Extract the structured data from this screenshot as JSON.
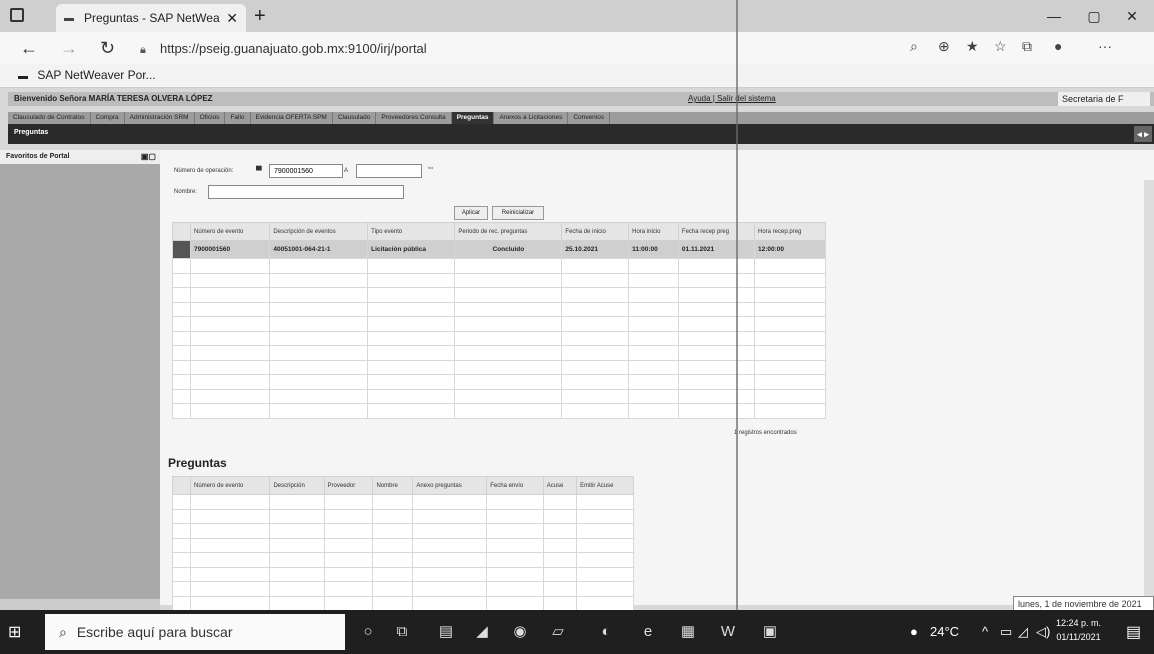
{
  "browser": {
    "tab_title": "Preguntas - SAP NetWeaver Port",
    "tab_close": "✕",
    "new_tab": "+",
    "url": "https://pseig.guanajuato.gob.mx:9100/irj/portal",
    "favorite": "SAP NetWeaver Por...",
    "win_min": "—",
    "win_max": "▢",
    "win_close": "✕"
  },
  "portal": {
    "welcome": "Bienvenido Señora MARÍA TERESA OLVERA LÓPEZ",
    "links": "Ayuda | Salir del sistema",
    "secretaria": "Secretaria de F",
    "nav_tabs": [
      "Clausulado de Contratos",
      "Compra",
      "Administración SRM",
      "Oficios",
      "Fallo",
      "Evidencia OFERTA SPM",
      "Clausulado",
      "Proveedores Consulta",
      "Preguntas",
      "Anexos a Licitaciones",
      "Convenios"
    ],
    "active_tab": "Preguntas",
    "subnav": "Preguntas",
    "left_title": "Favoritos de Portal"
  },
  "search": {
    "op_label": "Número de operación:",
    "op_value": "7900001560",
    "a_label": "A",
    "name_label": "Nombre:",
    "apply": "Aplicar",
    "reset": "Reinicializar"
  },
  "events_table": {
    "headers": [
      "Número de evento",
      "Descripción de eventos",
      "Tipo evento",
      "Periodo de rec. preguntas",
      "Fecha de inicio",
      "Hora inicio",
      "Fecha recep preg",
      "Hora recep.preg"
    ],
    "rows": [
      [
        "7900001560",
        "40051001-064-21-1",
        "Licitación pública",
        "Concluido",
        "25.10.2021",
        "11:00:00",
        "01.11.2021",
        "12:00:00"
      ]
    ],
    "records": "1  registros encontrados"
  },
  "preguntas": {
    "title": "Preguntas",
    "headers": [
      "Número de evento",
      "Descripción",
      "Proveedor",
      "Nombre",
      "Anexo preguntas",
      "Fecha envío",
      "Acuse",
      "Emitir Acuse"
    ]
  },
  "tooltip": "lunes, 1 de noviembre de 2021",
  "taskbar": {
    "search_placeholder": "Escribe aquí para buscar",
    "temp": "24°C",
    "time": "12:24 p. m.",
    "date": "01/11/2021"
  }
}
